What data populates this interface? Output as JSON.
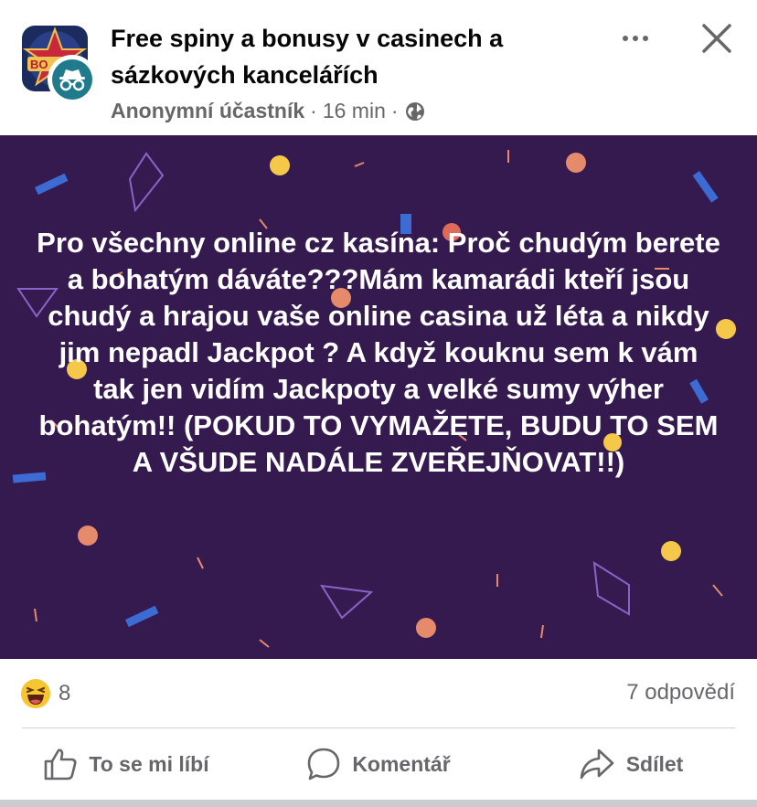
{
  "header": {
    "group_name": "Free spiny a bonusy v casinech a sázkových kancelářích",
    "author": "Anonymní účastník",
    "separator": "·",
    "time": "16 min",
    "separator2": "·",
    "avatar_icon": "casino-bonus-logo",
    "badge_icon": "anonymous-incognito-icon",
    "privacy_icon": "globe-icon",
    "more_icon": "more-dots-icon",
    "close_icon": "close-icon"
  },
  "post": {
    "background_color": "#351a4f",
    "text": "Pro všechny online cz kasína: Proč chudým berete a bohatým dáváte???Mám kamarádi kteří jsou chudý a hrajou vaše online casina už léta a nikdy jim nepadl Jackpot ? A když kouknu sem k vám tak jen vidím Jackpoty a velké sumy výher bohatým!! (POKUD TO VYMAŽETE, BUDU TO SEM A VŠUDE NADÁLE ZVEŘEJŇOVAT!!)"
  },
  "stats": {
    "reaction_icon": "haha-reaction-icon",
    "reaction_count": "8",
    "replies": "7 odpovědí"
  },
  "actions": {
    "like_label": "To se mi líbí",
    "comment_label": "Komentář",
    "share_label": "Sdílet",
    "like_icon": "thumbs-up-icon",
    "comment_icon": "comment-bubble-icon",
    "share_icon": "share-arrow-icon"
  },
  "colors": {
    "meta_gray": "#65676b",
    "accent_teal": "#1f7a8c",
    "haha_yellow": "#f7c530"
  }
}
